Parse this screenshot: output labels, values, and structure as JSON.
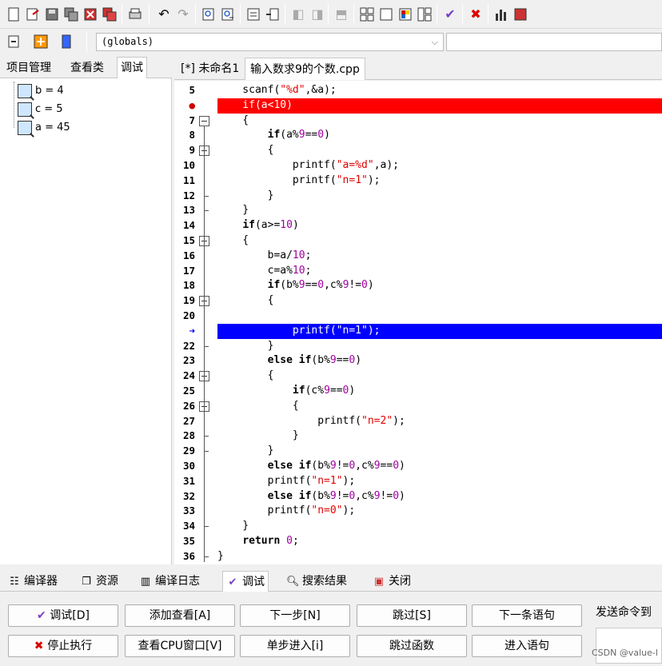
{
  "toolbar": {
    "icons": [
      "new-file-icon",
      "open-icon",
      "save-icon",
      "save-all-icon",
      "close-icon",
      "close-all-icon",
      "print-icon",
      "undo-icon",
      "redo-icon",
      "find-icon",
      "replace-icon",
      "indent-icon",
      "unindent-icon",
      "compile-icon",
      "run-icon",
      "compile-run-icon",
      "grid-icon",
      "window-icon",
      "color-icon",
      "layout-icon",
      "check-icon",
      "stop-icon",
      "chart-icon",
      "class-icon"
    ],
    "globals_value": "(globals)"
  },
  "left_tabs": [
    "项目管理",
    "查看类",
    "调试"
  ],
  "watch_items": [
    "b = 4",
    "c = 5",
    "a = 45"
  ],
  "doc_tabs": [
    "[*] 未命名1",
    "输入数求9的个数.cpp"
  ],
  "line_numbers": [
    "5",
    "6",
    "7",
    "8",
    "9",
    "10",
    "11",
    "12",
    "13",
    "14",
    "15",
    "16",
    "17",
    "18",
    "19",
    "20",
    "21",
    "22",
    "23",
    "24",
    "25",
    "26",
    "27",
    "28",
    "29",
    "30",
    "31",
    "32",
    "33",
    "34",
    "35",
    "36"
  ],
  "code_lines": [
    "    scanf(\"%d\",&a);",
    "    if(a<10)",
    "    {",
    "        if(a%9==0)",
    "        {",
    "            printf(\"a=%d\",a);",
    "            printf(\"n=1\");",
    "        }",
    "    }",
    "    if(a>=10)",
    "    {",
    "        b=a/10;",
    "        c=a%10;",
    "        if(b%9==0,c%9!=0)",
    "        {",
    "",
    "            printf(\"n=1\");",
    "        }",
    "        else if(b%9==0)",
    "        {",
    "            if(c%9==0)",
    "            {",
    "                printf(\"n=2\");",
    "            }",
    "        }",
    "        else if(b%9!=0,c%9==0)",
    "        printf(\"n=1\");",
    "        else if(b%9!=0,c%9!=0)",
    "        printf(\"n=0\");",
    "    }",
    "    return 0;",
    "}"
  ],
  "bottom_tabs": [
    "编译器",
    "资源",
    "编译日志",
    "调试",
    "搜索结果",
    "关闭"
  ],
  "buttons": {
    "debug": "调试[D]",
    "add_watch": "添加查看[A]",
    "next_step": "下一步[N]",
    "skip": "跳过[S]",
    "next_statement": "下一条语句",
    "stop": "停止执行",
    "cpu_window": "查看CPU窗口[V]",
    "step_into": "单步进入[i]",
    "skip_function": "跳过函数",
    "into_statement": "进入语句"
  },
  "send_command_label": "发送命令到",
  "watermark": "CSDN @value-l",
  "colors": {
    "breakpoint": "#ff0000",
    "current_line": "#0000ff",
    "string": "#e00000",
    "number": "#a000a0"
  }
}
